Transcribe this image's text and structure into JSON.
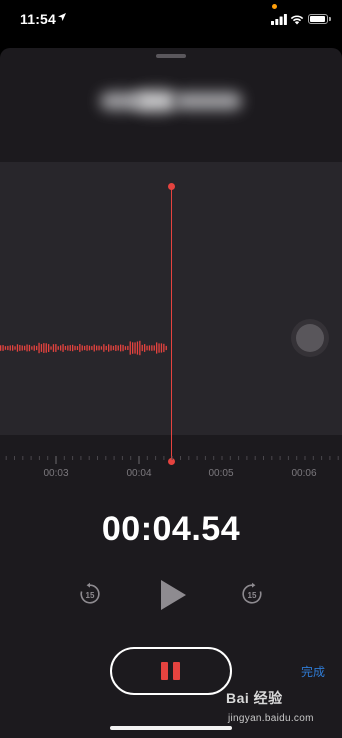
{
  "status_bar": {
    "time": "11:54",
    "location_icon": "location-arrow-icon",
    "signal_icon": "cellular-signal-icon",
    "wifi_icon": "wifi-icon",
    "battery_icon": "battery-icon",
    "privacy_indicator_color": "#ff9f0a"
  },
  "recording": {
    "title_redacted": true
  },
  "waveform": {
    "played_color": "#e5433f",
    "playhead_color": "#e5433f",
    "timeline_labels": [
      "00:03",
      "00:04",
      "00:05",
      "00:06"
    ]
  },
  "timer": {
    "elapsed": "00:04.54"
  },
  "controls": {
    "skip_back_icon": "skip-back-15-icon",
    "skip_back_seconds": "15",
    "play_icon": "play-icon",
    "skip_forward_icon": "skip-forward-15-icon",
    "skip_forward_seconds": "15",
    "pause_icon": "pause-icon",
    "done_label": "完成"
  },
  "watermark": {
    "title": "Bai 经验",
    "subtitle": "jingyan.baidu.com"
  },
  "colors": {
    "background": "#000000",
    "sheet": "#1c1a1e",
    "wave_panel": "#28262b",
    "accent_red": "#e5433f",
    "link_blue": "#2f7bd4"
  }
}
